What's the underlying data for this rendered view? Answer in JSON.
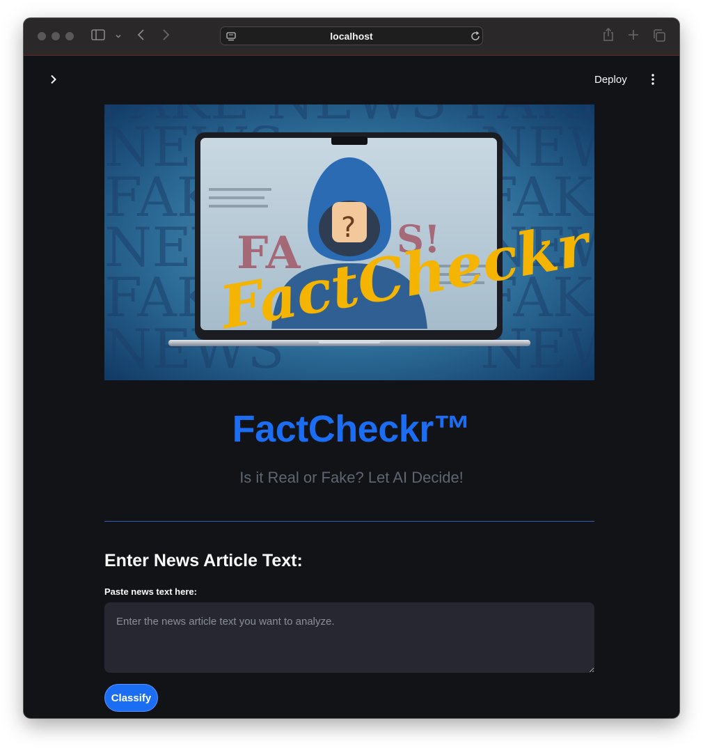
{
  "browser": {
    "address": "localhost"
  },
  "app": {
    "deploy_label": "Deploy",
    "hero_logo_text": "FactCheckr",
    "hero_background_words": [
      "NEWS",
      "FAKE",
      "FAKE",
      "NEWS",
      "NEWS",
      "FAKE",
      "FAKE",
      "NEWS",
      "NEWS",
      "FAKE",
      "NEWS"
    ],
    "title": "FactCheckr™",
    "subtitle": "Is it Real or Fake? Let AI Decide!",
    "section_heading": "Enter News Article Text:",
    "field_label": "Paste news text here:",
    "textarea_placeholder": "Enter the news article text you want to analyze.",
    "textarea_value": "",
    "classify_label": "Classify"
  },
  "colors": {
    "accent": "#1b6ef3",
    "background": "#121317",
    "input_bg": "#262730",
    "logo_gold": "#f4b400"
  }
}
